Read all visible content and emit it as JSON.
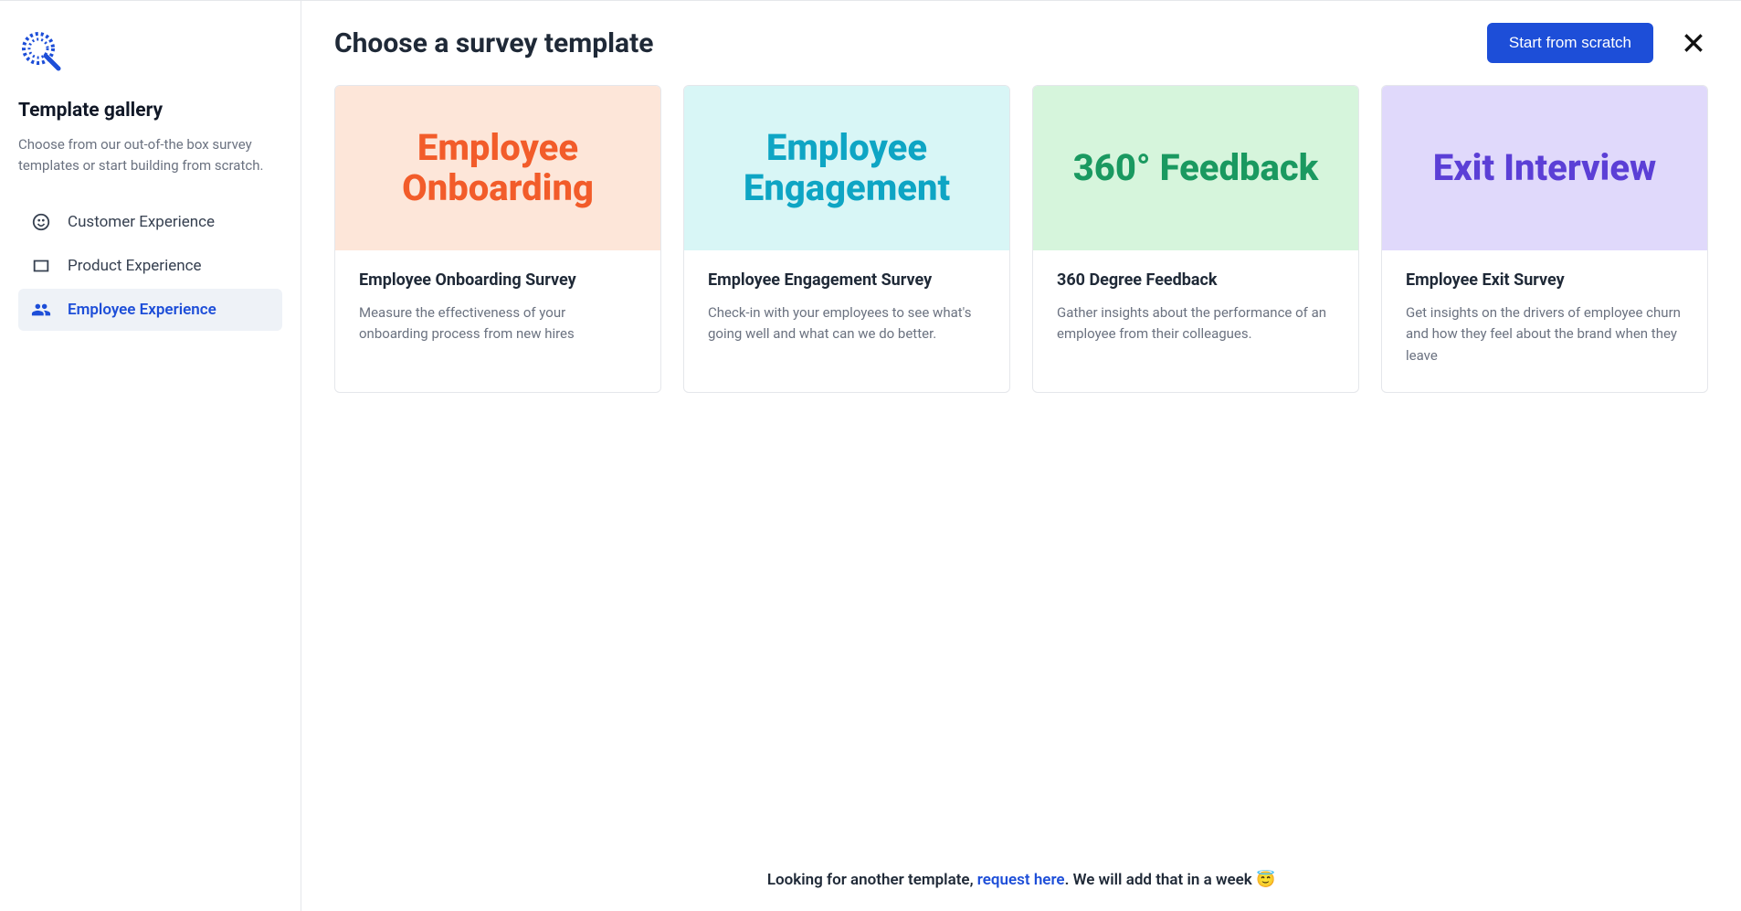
{
  "sidebar": {
    "title": "Template gallery",
    "description": "Choose from our out-of-the box survey templates or start building from scratch.",
    "nav": [
      {
        "label": "Customer Experience",
        "icon": "smile-icon",
        "active": false
      },
      {
        "label": "Product Experience",
        "icon": "window-icon",
        "active": false
      },
      {
        "label": "Employee Experience",
        "icon": "people-icon",
        "active": true
      }
    ]
  },
  "header": {
    "title": "Choose a survey template",
    "start_button": "Start from scratch"
  },
  "templates": [
    {
      "hero_text": "Employee Onboarding",
      "hero_bg": "#fde6d9",
      "hero_color": "#f25c2a",
      "title": "Employee Onboarding Survey",
      "description": "Measure the effectiveness of your onboarding process from new hires"
    },
    {
      "hero_text": "Employee Engagement",
      "hero_bg": "#d8f6f6",
      "hero_color": "#0ea5c4",
      "title": "Employee Engagement Survey",
      "description": "Check-in with your employees to see what's going well and what can we do better."
    },
    {
      "hero_text": "360° Feedback",
      "hero_bg": "#d6f5dc",
      "hero_color": "#1a9960",
      "title": "360 Degree Feedback",
      "description": "Gather insights about the performance of an employee from their colleagues."
    },
    {
      "hero_text": "Exit Interview",
      "hero_bg": "#e0d9fb",
      "hero_color": "#5b3fd6",
      "title": "Employee Exit Survey",
      "description": "Get insights on the drivers of employee churn and how they feel about the brand when they leave"
    }
  ],
  "footer": {
    "prefix": "Looking for another template, ",
    "link": "request here",
    "suffix": ". We will add that in a week 😇"
  }
}
